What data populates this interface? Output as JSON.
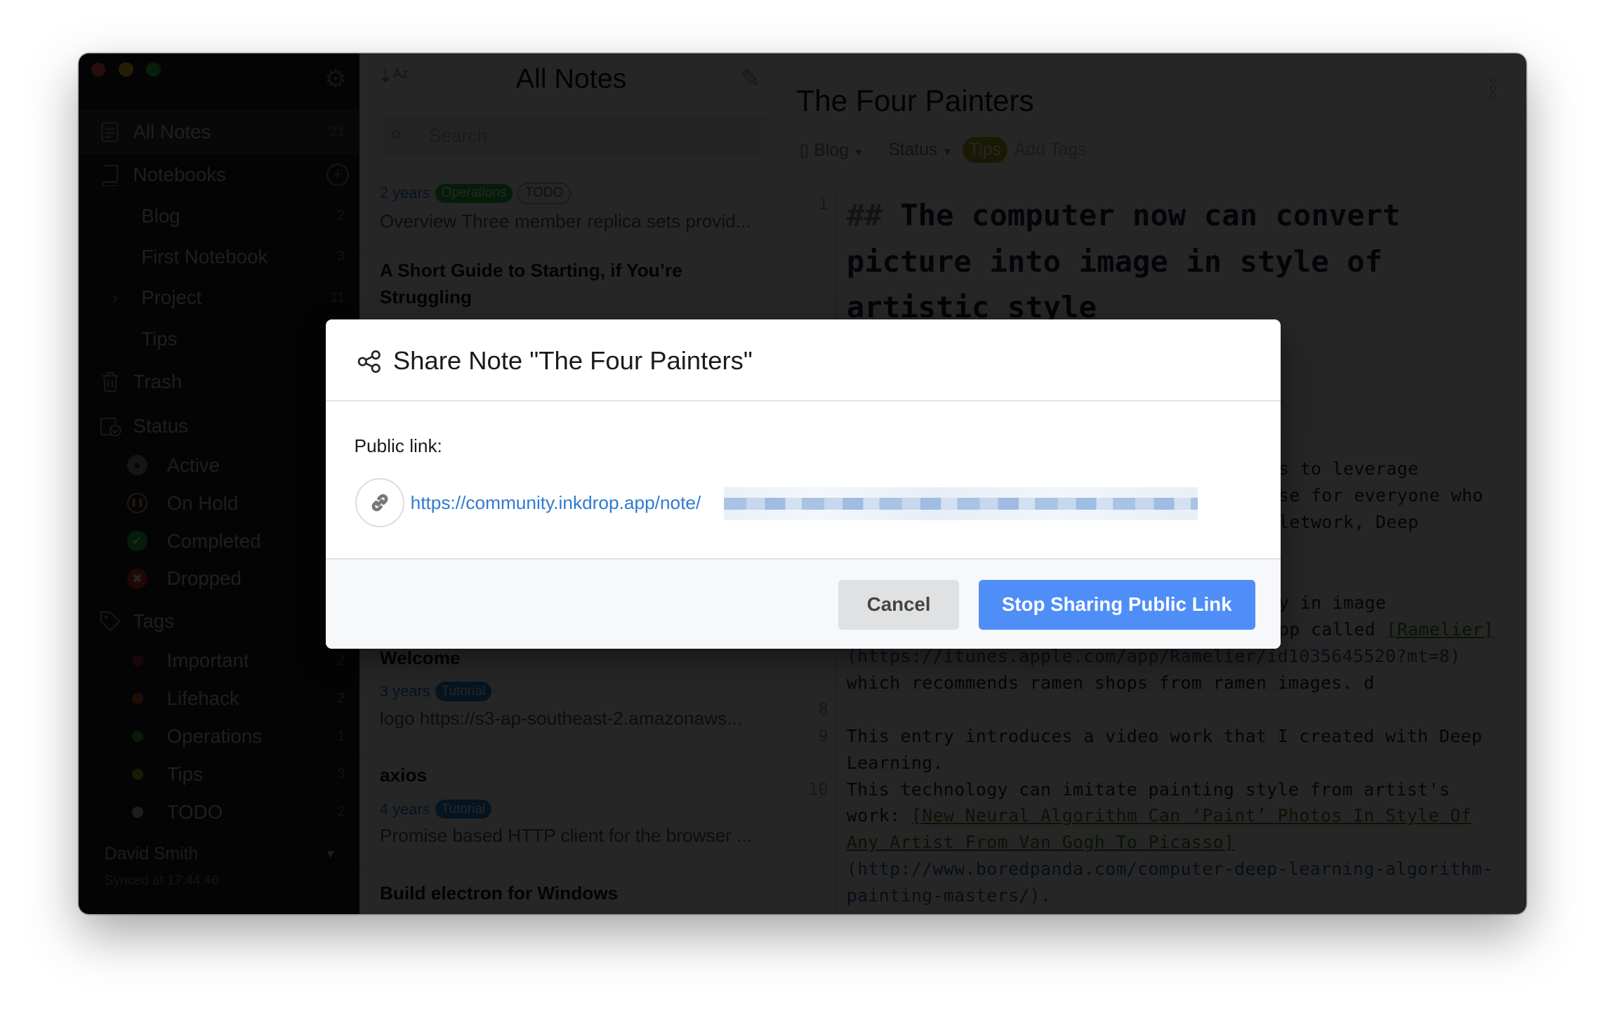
{
  "sidebar": {
    "all_notes": {
      "label": "All Notes",
      "count": "21"
    },
    "notebooks_label": "Notebooks",
    "notebooks": [
      {
        "label": "Blog",
        "count": "2"
      },
      {
        "label": "First Notebook",
        "count": "3"
      },
      {
        "label": "Project",
        "count": "11"
      },
      {
        "label": "Tips",
        "count": ""
      }
    ],
    "trash_label": "Trash",
    "status_label": "Status",
    "statuses": [
      {
        "label": "Active",
        "color": "#888a8e"
      },
      {
        "label": "On Hold",
        "color": "#e8a33a"
      },
      {
        "label": "Completed",
        "color": "#21ba45"
      },
      {
        "label": "Dropped",
        "color": "#db2828"
      }
    ],
    "tags_label": "Tags",
    "tags": [
      {
        "label": "Important",
        "count": "2",
        "color": "#a3205a"
      },
      {
        "label": "Lifehack",
        "count": "2",
        "color": "#c8591c"
      },
      {
        "label": "Operations",
        "count": "1",
        "color": "#21ba45"
      },
      {
        "label": "Tips",
        "count": "3",
        "color": "#a7a81d"
      },
      {
        "label": "TODO",
        "count": "2",
        "color": "#c8c8c8"
      }
    ],
    "user": "David Smith",
    "synced": "Synced at 17:44:46"
  },
  "list": {
    "title": "All Notes",
    "search_placeholder": "Search",
    "notes": [
      {
        "title": "",
        "age": "2 years",
        "tags": [
          "Operations",
          "TODO"
        ],
        "preview": "Overview Three member replica sets provid..."
      },
      {
        "title": "A Short Guide to Starting, if You’re Struggling",
        "age": "",
        "tags": [],
        "preview": ""
      },
      {
        "title": "Welcome",
        "age": "3 years",
        "tags": [
          "Tutorial"
        ],
        "preview": "logo https://s3-ap-southeast-2.amazonaws..."
      },
      {
        "title": "axios",
        "age": "4 years",
        "tags": [
          "Tutorial"
        ],
        "preview": "Promise based HTTP client for the browser ..."
      },
      {
        "title": "Build electron for Windows",
        "age": "",
        "tags": [],
        "preview": ""
      }
    ]
  },
  "editor": {
    "title": "The Four Painters",
    "notebook": "Blog",
    "status": "Status",
    "tag": "Tips",
    "add_tags": "Add Tags",
    "heading_marker": "##",
    "heading_lines": [
      "The computer now can convert",
      "picture into image in style of",
      "artistic style"
    ],
    "fragments": [
      "s to leverage",
      "se for everyone who",
      "letwork, Deep",
      "y in image",
      "pp called "
    ],
    "fragment_link": "[Ramelier]",
    "lines": [
      {
        "num": "",
        "text": "(https://itunes.apple.com/app/Ramelier/id1035645520?mt=8)",
        "kind": "url"
      },
      {
        "num": "",
        "text": "which recommends ramen shops from ramen images. d",
        "kind": "text"
      },
      {
        "num": "8",
        "text": "",
        "kind": "text"
      },
      {
        "num": "9",
        "text": "This entry introduces a video work that I created with Deep",
        "kind": "text"
      },
      {
        "num": "",
        "text": "Learning.",
        "kind": "text"
      },
      {
        "num": "10",
        "text": "This technology can imitate painting style from artist's",
        "kind": "text"
      }
    ],
    "work_prefix": "work: ",
    "link_line1": "[New Neural Algorithm Can ‘Paint’ Photos In Style Of",
    "link_line2": "Any Artist From Van Gogh To Picasso]",
    "url_line1": "(http://www.boredpanda.com/computer-deep-learning-algorithm-",
    "url_line2": "painting-masters/).",
    "line1_num": "1"
  },
  "dialog": {
    "title": "Share Note \"The Four Painters\"",
    "public_link_label": "Public link:",
    "url": "https://community.inkdrop.app/note/",
    "cancel": "Cancel",
    "stop_sharing": "Stop Sharing Public Link"
  },
  "colors": {
    "accent": "#4f8ef7",
    "link": "#2f7bd0",
    "overlay": "rgba(0,0,0,0.85)"
  }
}
